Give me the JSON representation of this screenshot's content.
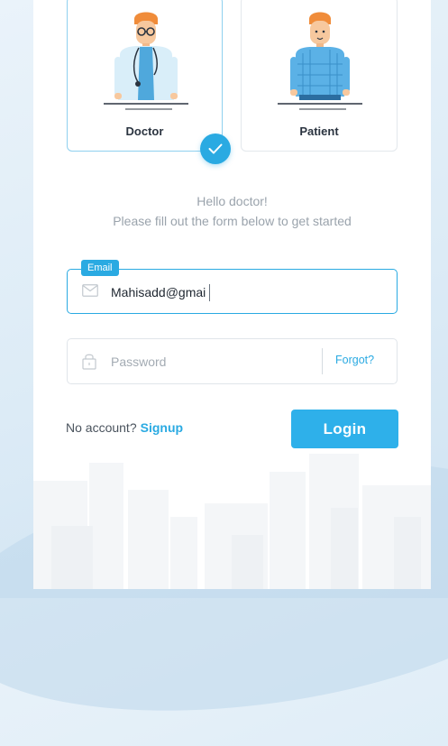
{
  "roles": {
    "doctor_label": "Doctor",
    "patient_label": "Patient",
    "selected": "Doctor"
  },
  "greeting": {
    "line1": "Hello doctor!",
    "line2": "Please fill out the form below to get started"
  },
  "email": {
    "tag": "Email",
    "value": "Mahisadd@gmai",
    "icon": "envelope-icon"
  },
  "password": {
    "placeholder": "Password",
    "icon": "lock-icon",
    "forgot_label": "Forgot?"
  },
  "footer": {
    "no_account_label": "No account?",
    "signup_label": "Signup",
    "login_label": "Login"
  },
  "colors": {
    "accent": "#2aaae2",
    "text_dark": "#2b3440",
    "text_muted": "#9aa3ac"
  }
}
